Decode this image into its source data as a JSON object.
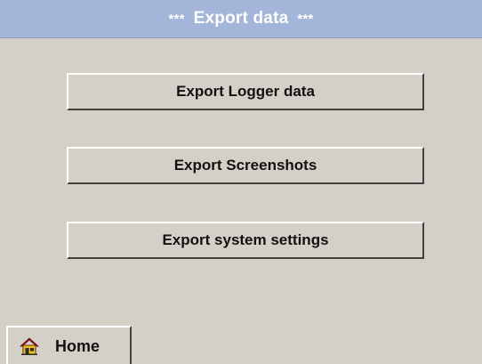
{
  "header": {
    "stars_left": "***",
    "title": "Export data",
    "stars_right": "***"
  },
  "buttons": {
    "export_logger_data": "Export Logger data",
    "export_screenshots": "Export Screenshots",
    "export_system_settings": "Export system settings"
  },
  "footer": {
    "home_label": "Home",
    "home_icon": "house-icon"
  },
  "colors": {
    "background": "#d4d0c8",
    "title_bar": "#a3b6d9",
    "title_text": "#ffffff",
    "house_roof": "#b5121b",
    "house_body": "#f0c020"
  }
}
